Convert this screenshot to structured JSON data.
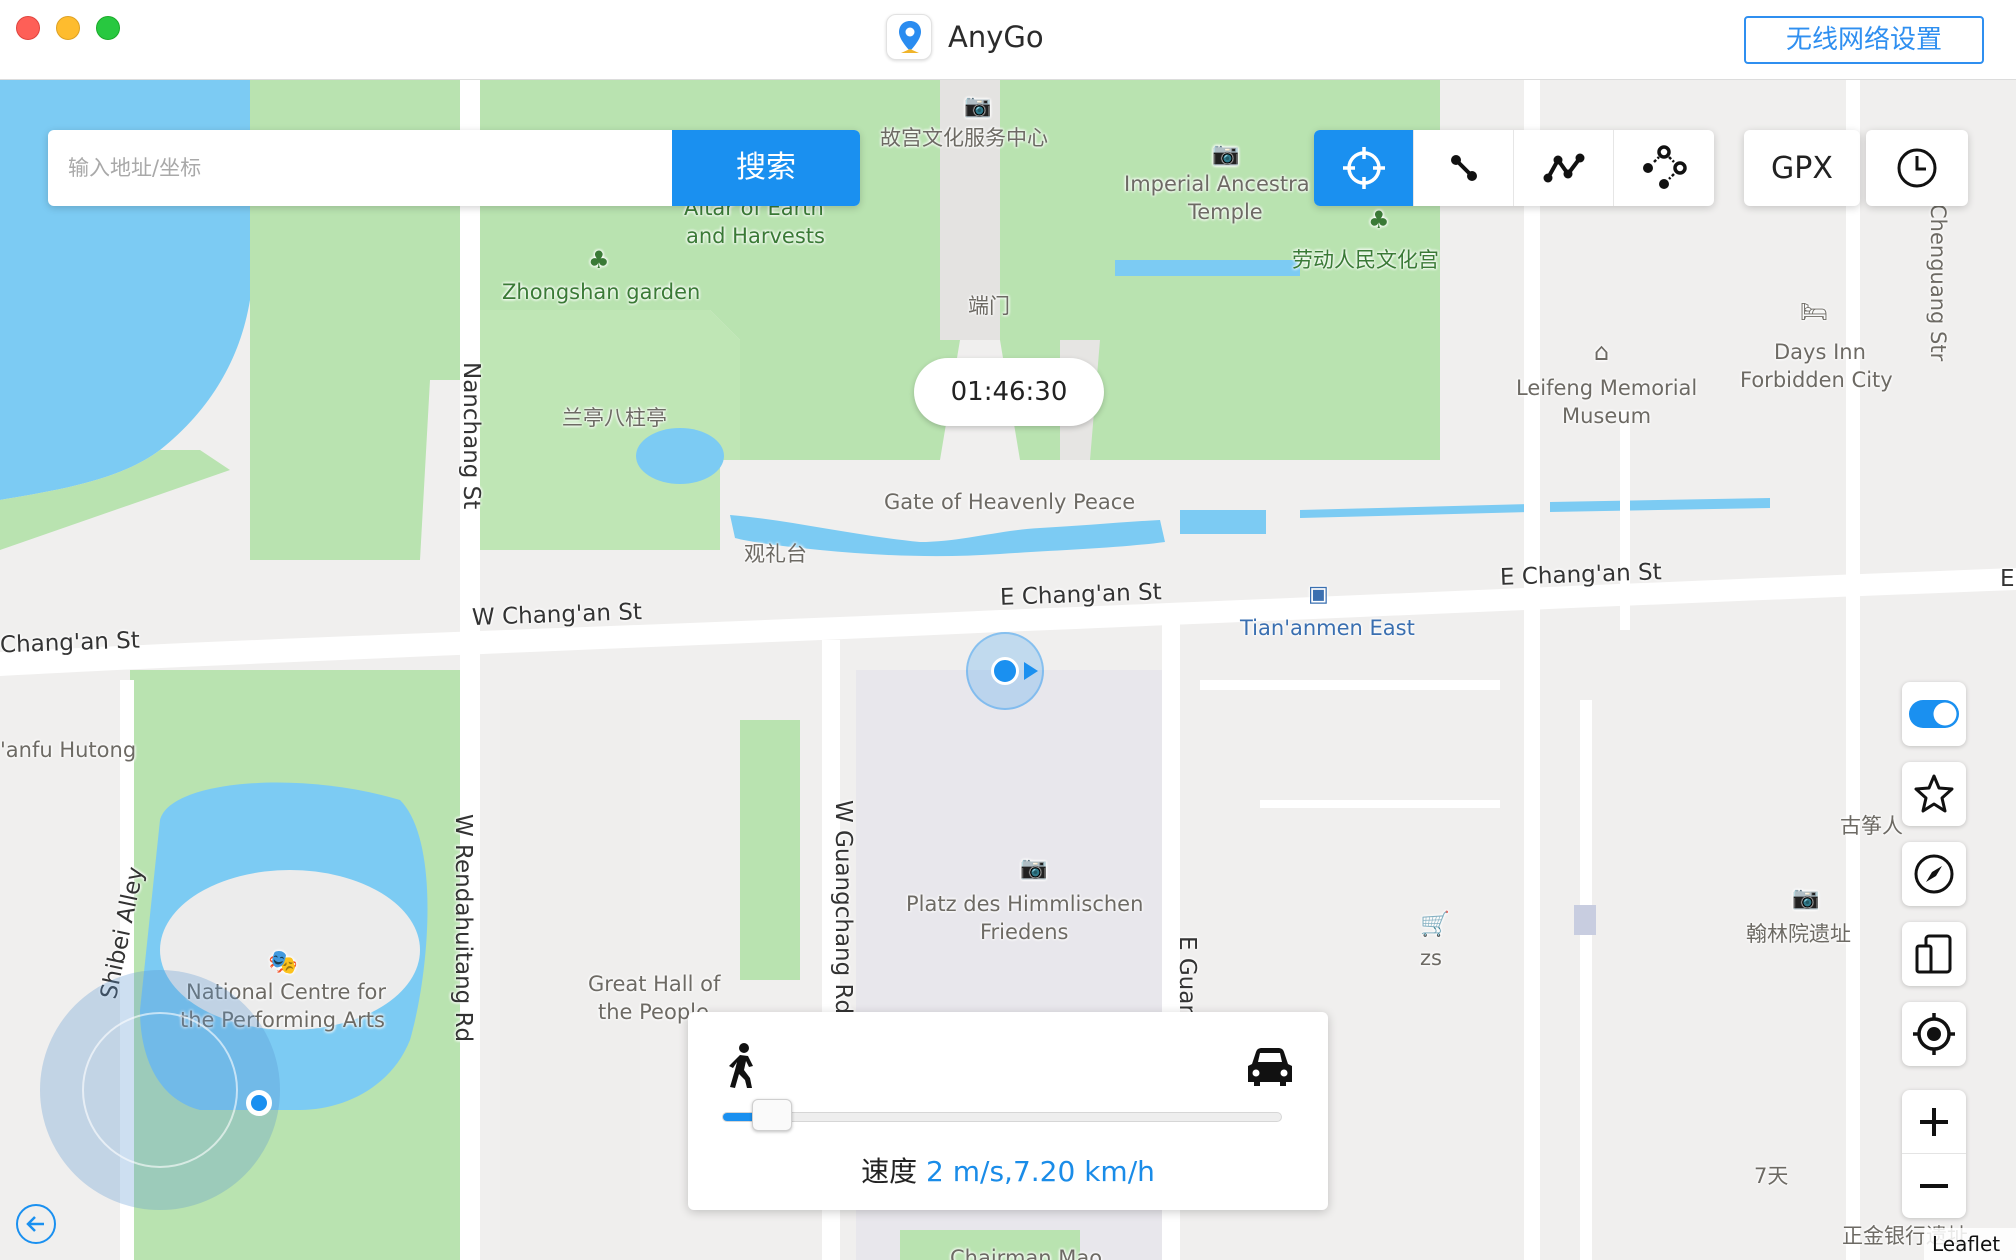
{
  "window": {
    "title": "AnyGo",
    "wifi_settings_label": "无线网络设置"
  },
  "search": {
    "placeholder": "输入地址/坐标",
    "button_label": "搜索"
  },
  "modes": [
    {
      "name": "teleport",
      "icon": "crosshair-icon",
      "active": true
    },
    {
      "name": "two-spot",
      "icon": "two-spot-route-icon",
      "active": false
    },
    {
      "name": "multi-spot",
      "icon": "multi-spot-route-icon",
      "active": false
    },
    {
      "name": "jump",
      "icon": "jump-teleport-icon",
      "active": false
    }
  ],
  "tools": {
    "gpx_label": "GPX",
    "history_icon": "clock-icon"
  },
  "timer": {
    "value": "01:46:30"
  },
  "sidebar": {
    "toggle_on": true,
    "items": [
      "toggle-switch",
      "star-icon",
      "compass-icon",
      "devices-icon",
      "locate-icon"
    ],
    "zoom_in": "+",
    "zoom_out": "−"
  },
  "speed": {
    "label": "速度",
    "value": "2 m/s,7.20 km/h",
    "level": 0.054,
    "min_icon": "walk-icon",
    "max_icon": "car-icon"
  },
  "map": {
    "attribution": "Leaflet",
    "labels": {
      "l1": "故宫文化服务中心",
      "l2": "Imperial Ancestra",
      "l3": "Temple",
      "l4": "劳动人民文化宫",
      "l5": "Altar of Earth",
      "l6": "and Harvests",
      "l7": "Zhongshan garden",
      "l8": "端门",
      "l9": "兰亭八柱亭",
      "l10": "Gate of Heavenly Peace",
      "l11": "观礼台",
      "l12": "Leifeng Memorial",
      "l13": "Museum",
      "l14": "Days Inn",
      "l15": "Forbidden City",
      "l16": "Chenguang Str",
      "l17": "Nanchang St",
      "l18": "W Chang'an St",
      "l19": "Chang'an St",
      "l20": "E Chang'an St",
      "l21": "E Chang'an St",
      "l22": "Tian'anmen East",
      "l23": "'anfu Hutong",
      "l24": "W Rendahuitang Rd",
      "l25": "W Guangchang Rd",
      "l26": "E Guangchan",
      "l27": "Shibei Alley",
      "l28": "National Centre for",
      "l29": "the Performing Arts",
      "l30": "Great Hall of",
      "l31": "the People",
      "l32": "Platz des Himmlischen",
      "l33": "Friedens",
      "l34": "zs",
      "l35": "古筝人",
      "l36": "翰林院遗址",
      "l37": "7天",
      "l38": "正金银行遗址",
      "l39": "Chairman Mao",
      "l40": "E"
    }
  }
}
